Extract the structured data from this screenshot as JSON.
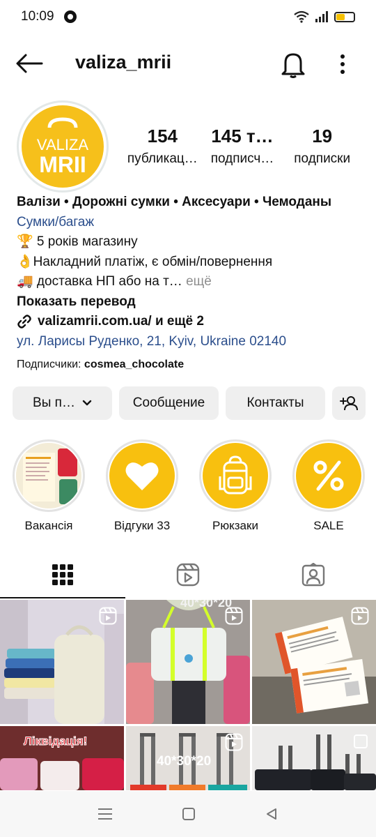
{
  "status_bar": {
    "time": "10:09",
    "icons": [
      "whatsapp-icon",
      "wifi-icon",
      "signal-icon",
      "battery-icon"
    ],
    "battery_color": "#f5c000"
  },
  "header": {
    "username": "valiza_mrii",
    "icons": [
      "back-arrow-icon",
      "bell-icon",
      "more-vertical-icon"
    ]
  },
  "profile": {
    "avatar_logo_line1": "VALIZA",
    "avatar_logo_line2": "MRII",
    "avatar_color": "#f6c01b",
    "stats": [
      {
        "value": "154",
        "label": "публикац…"
      },
      {
        "value": "145 т…",
        "label": "подписч…"
      },
      {
        "value": "19",
        "label": "подписки"
      }
    ]
  },
  "bio": {
    "title": "Валізи • Дорожні сумки • Аксесуари • Чемоданы",
    "category": "Сумки/багаж",
    "line1": "🏆 5 років магазину",
    "line2": "👌Накладний платіж, є обмін/повернення",
    "line3": "🚚 доставка НП або на т…",
    "more": "ещё",
    "translate": "Показать перевод",
    "link": "valizamrii.com.ua/ и ещё 2",
    "address": "ул. Ларисы Руденко, 21, Kyiv, Ukraine 02140",
    "link_color": "#2b4e8c"
  },
  "followers": {
    "prefix": "Подписчики:",
    "name": "cosmea_chocolate"
  },
  "buttons": {
    "follow": "Вы п…",
    "message": "Сообщение",
    "contacts": "Контакты"
  },
  "highlights": [
    {
      "label": "Вакансія",
      "icon": "photo-thumbnail"
    },
    {
      "label": "Відгуки 33",
      "icon": "heart-icon"
    },
    {
      "label": "Рюкзаки",
      "icon": "backpack-icon"
    },
    {
      "label": "SALE",
      "icon": "percent-icon"
    }
  ],
  "highlight_color": "#f8c00f",
  "tabs": [
    {
      "name": "grid",
      "icon": "grid-icon",
      "active": true
    },
    {
      "name": "reels",
      "icon": "reels-icon",
      "active": false
    },
    {
      "name": "tagged",
      "icon": "tagged-person-icon",
      "active": false
    }
  ],
  "grid_posts": [
    {
      "overlay_text": ""
    },
    {
      "overlay_text": "40*30*20"
    },
    {
      "overlay_text": ""
    },
    {
      "overlay_text": "Ліквідація!"
    },
    {
      "overlay_text": "40*30*20"
    },
    {
      "overlay_text": ""
    }
  ],
  "nav_icons": [
    "menu-icon",
    "home-square-icon",
    "back-triangle-icon"
  ]
}
